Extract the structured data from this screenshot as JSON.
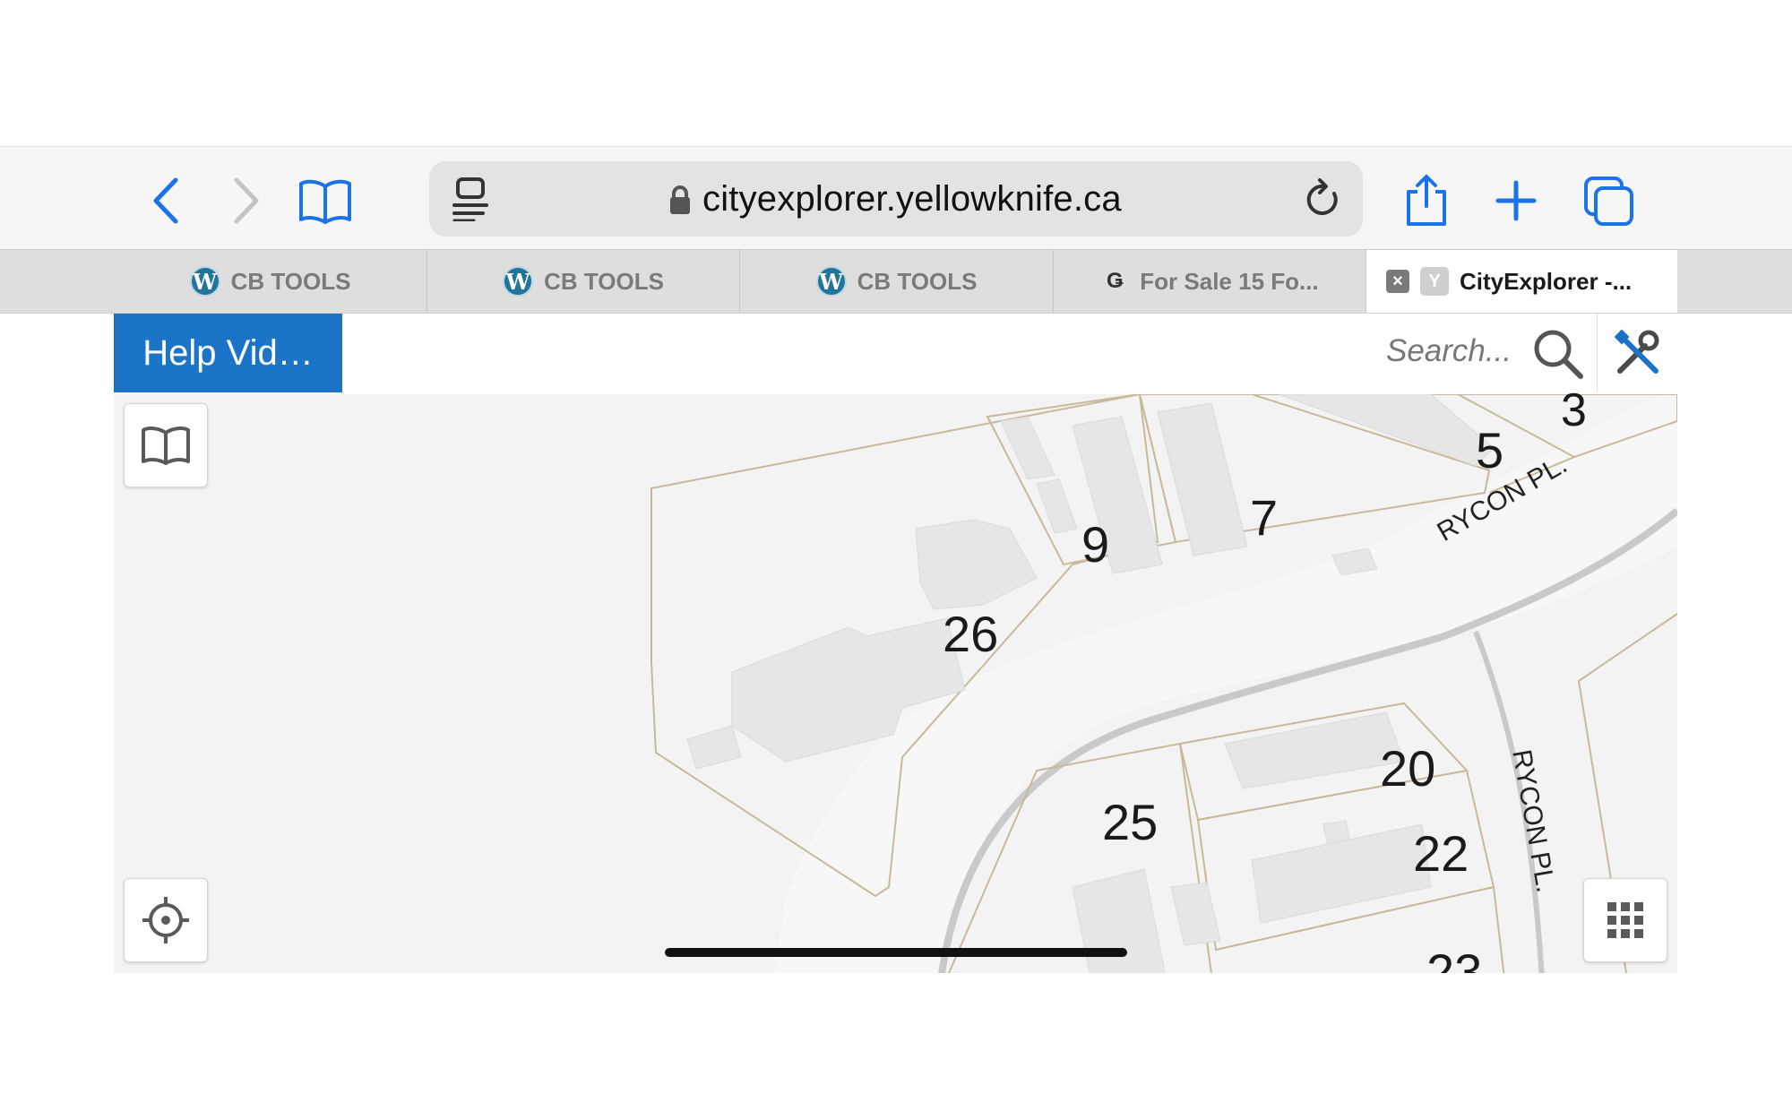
{
  "browser": {
    "url": "cityexplorer.yellowknife.ca",
    "icons": {
      "back": "chevron-left-icon",
      "forward": "chevron-right-icon",
      "bookmarks": "book-icon",
      "reader": "reader-icon",
      "lock": "lock-icon",
      "reload": "reload-icon",
      "share": "share-icon",
      "new_tab": "plus-icon",
      "tabs": "tabs-icon"
    },
    "accent_color": "#1c74c9"
  },
  "tabs": [
    {
      "label": "CB TOOLS",
      "icon": "wordpress-icon"
    },
    {
      "label": "CB TOOLS",
      "icon": "wordpress-icon"
    },
    {
      "label": "CB TOOLS",
      "icon": "wordpress-icon"
    },
    {
      "label": "For Sale 15 Fo...",
      "icon": "gb-logo-icon"
    },
    {
      "label": "CityExplorer -...",
      "icon": "y-favicon",
      "active": true,
      "favicon_letter": "Y",
      "close_symbol": "×"
    }
  ],
  "app": {
    "help_button": "Help Vid…",
    "search_placeholder": "Search...",
    "map": {
      "lot_numbers": [
        "3",
        "5",
        "7",
        "9",
        "26",
        "25",
        "20",
        "22",
        "23"
      ],
      "street_labels": [
        "RYCON PL.",
        "RYCON PL."
      ]
    }
  }
}
